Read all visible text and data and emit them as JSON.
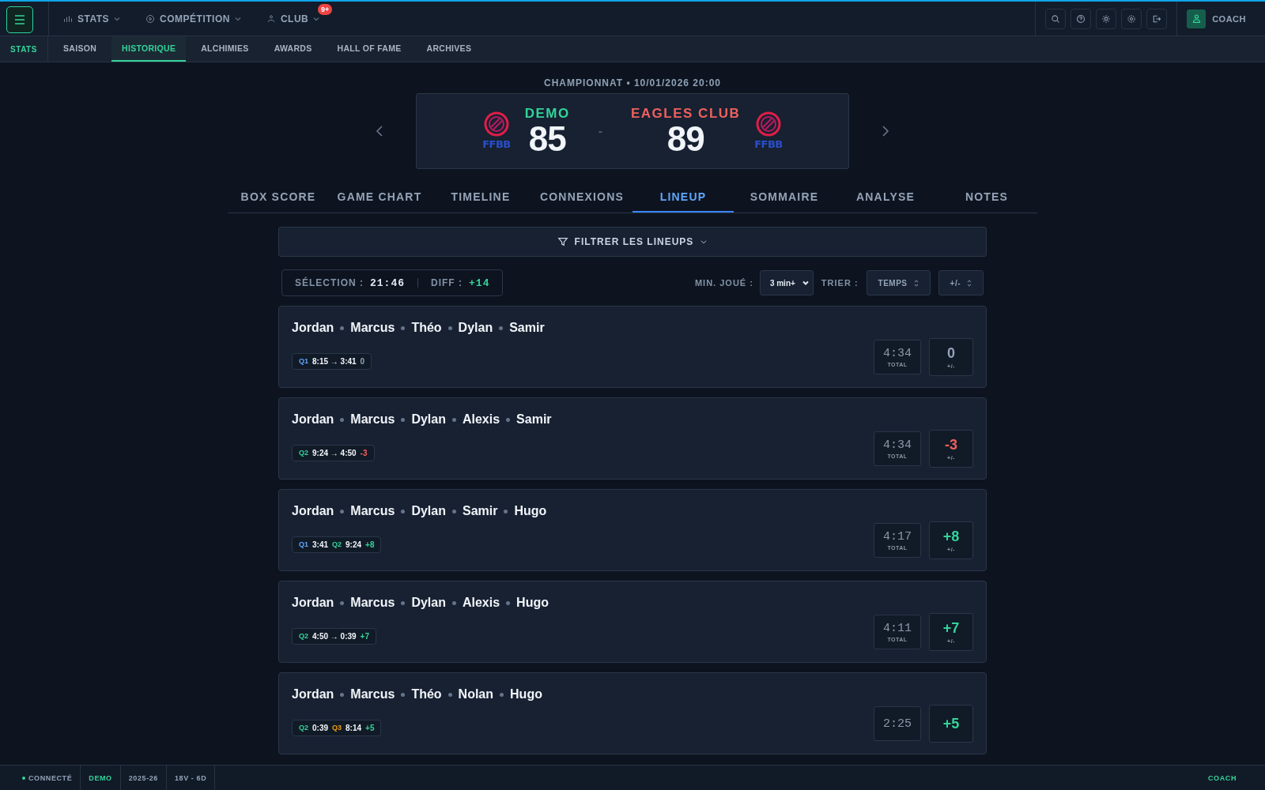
{
  "top_nav": {
    "items": [
      {
        "label": "STATS"
      },
      {
        "label": "COMPÉTITION"
      },
      {
        "label": "CLUB",
        "badge": "9+"
      }
    ],
    "user": {
      "label": "COACH"
    }
  },
  "sub_nav": {
    "section": "STATS",
    "tabs": [
      {
        "label": "SAISON",
        "selected": false
      },
      {
        "label": "HISTORIQUE",
        "selected": true
      },
      {
        "label": "ALCHIMIES",
        "selected": false
      },
      {
        "label": "AWARDS",
        "selected": false
      },
      {
        "label": "HALL OF FAME",
        "selected": false
      },
      {
        "label": "ARCHIVES",
        "selected": false
      }
    ]
  },
  "match": {
    "subtitle": "CHAMPIONNAT • 10/01/2026 20:00",
    "separator": "-",
    "home": {
      "name": "DEMO",
      "score": "85",
      "logo_text": "FFBB",
      "color": "#34d399"
    },
    "away": {
      "name": "EAGLES CLUB",
      "score": "89",
      "logo_text": "FFBB",
      "color": "#f0605d"
    }
  },
  "view_tabs": [
    {
      "label": "BOX SCORE",
      "selected": false
    },
    {
      "label": "GAME CHART",
      "selected": false
    },
    {
      "label": "TIMELINE",
      "selected": false
    },
    {
      "label": "CONNEXIONS",
      "selected": false
    },
    {
      "label": "LINEUP",
      "selected": true
    },
    {
      "label": "SOMMAIRE",
      "selected": false
    },
    {
      "label": "ANALYSE",
      "selected": false
    },
    {
      "label": "NOTES",
      "selected": false
    }
  ],
  "filter": {
    "label": "FILTRER LES LINEUPS"
  },
  "summary": {
    "selection_label": "SÉLECTION :",
    "selection_value": "21:46",
    "diff_label": "DIFF :",
    "diff_value": "+14"
  },
  "controls": {
    "min_label": "MIN. JOUÉ :",
    "min_value": "3 min+",
    "sort_label": "TRIER :",
    "sort_buttons": [
      "TEMPS",
      "+/-"
    ]
  },
  "lineups": [
    {
      "players": [
        "Jordan",
        "Marcus",
        "Théo",
        "Dylan",
        "Samir"
      ],
      "chip": [
        {
          "kind": "quarter",
          "text": "Q1",
          "color": "#60a5fa"
        },
        {
          "kind": "time",
          "text": "8:15 → 3:41"
        },
        {
          "kind": "diff",
          "text": "0",
          "color": "#94a3b8"
        }
      ],
      "total": "4:34",
      "total_label": "TOTAL",
      "plus_minus": "0",
      "plus_minus_label": "+/-",
      "color": "#94a3b8"
    },
    {
      "players": [
        "Jordan",
        "Marcus",
        "Dylan",
        "Alexis",
        "Samir"
      ],
      "chip": [
        {
          "kind": "quarter",
          "text": "Q2",
          "color": "#34d399"
        },
        {
          "kind": "time",
          "text": "9:24 → 4:50"
        },
        {
          "kind": "diff",
          "text": "-3",
          "color": "#f0605d"
        }
      ],
      "total": "4:34",
      "total_label": "TOTAL",
      "plus_minus": "-3",
      "plus_minus_label": "+/-",
      "color": "#f0605d"
    },
    {
      "players": [
        "Jordan",
        "Marcus",
        "Dylan",
        "Samir",
        "Hugo"
      ],
      "chip": [
        {
          "kind": "quarter",
          "text": "Q1",
          "color": "#60a5fa"
        },
        {
          "kind": "time",
          "text": "3:41"
        },
        {
          "kind": "quarter",
          "text": "Q2",
          "color": "#34d399"
        },
        {
          "kind": "time",
          "text": "9:24"
        },
        {
          "kind": "diff",
          "text": "+8",
          "color": "#34d399"
        }
      ],
      "total": "4:17",
      "total_label": "TOTAL",
      "plus_minus": "+8",
      "plus_minus_label": "+/-",
      "color": "#34d399"
    },
    {
      "players": [
        "Jordan",
        "Marcus",
        "Dylan",
        "Alexis",
        "Hugo"
      ],
      "chip": [
        {
          "kind": "quarter",
          "text": "Q2",
          "color": "#34d399"
        },
        {
          "kind": "time",
          "text": "4:50 → 0:39"
        },
        {
          "kind": "diff",
          "text": "+7",
          "color": "#34d399"
        }
      ],
      "total": "4:11",
      "total_label": "TOTAL",
      "plus_minus": "+7",
      "plus_minus_label": "+/-",
      "color": "#34d399"
    },
    {
      "players": [
        "Jordan",
        "Marcus",
        "Théo",
        "Nolan",
        "Hugo"
      ],
      "chip": [
        {
          "kind": "quarter",
          "text": "Q2",
          "color": "#34d399"
        },
        {
          "kind": "time",
          "text": "0:39"
        },
        {
          "kind": "quarter",
          "text": "Q3",
          "color": "#f59e0b"
        },
        {
          "kind": "time",
          "text": "8:14"
        },
        {
          "kind": "diff",
          "text": "+5",
          "color": "#34d399"
        }
      ],
      "total": "2:25",
      "plus_minus": "+5",
      "color": "#34d399"
    }
  ],
  "status_bar": {
    "connection": "CONNECTÉ",
    "team": "DEMO",
    "season": "2025-26",
    "record": "18V - 6D",
    "role": "COACH"
  }
}
